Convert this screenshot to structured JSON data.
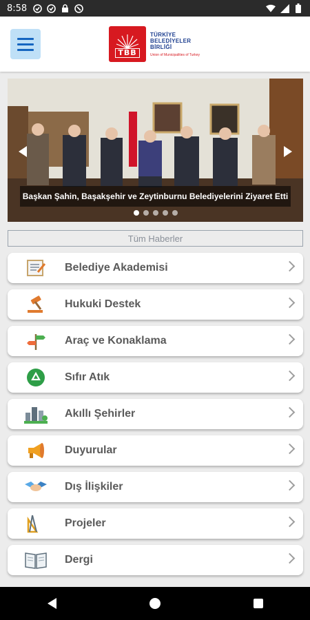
{
  "status_bar": {
    "time": "8:58",
    "left_icons": [
      "notification-icon",
      "notification-icon",
      "lock-icon",
      "notification-icon"
    ],
    "right_icons": [
      "wifi-icon",
      "signal-icon",
      "battery-icon"
    ]
  },
  "header": {
    "menu_icon": "hamburger-menu-icon",
    "logo": {
      "mark_letters": "TBB",
      "line1": "TÜRKİYE",
      "line2": "BELEDİYELER",
      "line3": "BİRLİĞİ",
      "subtitle": "Union of Municipalities of Turkey"
    }
  },
  "slider": {
    "caption": "Başkan Şahin, Başakşehir ve Zeytinburnu Belediyelerini Ziyaret Etti",
    "dot_count": 5,
    "active_dot": 0
  },
  "all_news_label": "Tüm Haberler",
  "menu": [
    {
      "label": "Belediye Akademisi",
      "icon": "certificate-icon"
    },
    {
      "label": "Hukuki Destek",
      "icon": "gavel-icon"
    },
    {
      "label": "Araç ve Konaklama",
      "icon": "signpost-icon"
    },
    {
      "label": "Sıfır Atık",
      "icon": "recycle-icon"
    },
    {
      "label": "Akıllı Şehirler",
      "icon": "city-icon"
    },
    {
      "label": "Duyurular",
      "icon": "megaphone-icon"
    },
    {
      "label": "Dış İlişkiler",
      "icon": "handshake-icon"
    },
    {
      "label": "Projeler",
      "icon": "drafting-tools-icon"
    },
    {
      "label": "Dergi",
      "icon": "open-book-icon"
    }
  ],
  "colors": {
    "brand_red": "#d71920",
    "brand_blue": "#1d3f8f",
    "menu_button_bg": "#bfe0f7"
  }
}
